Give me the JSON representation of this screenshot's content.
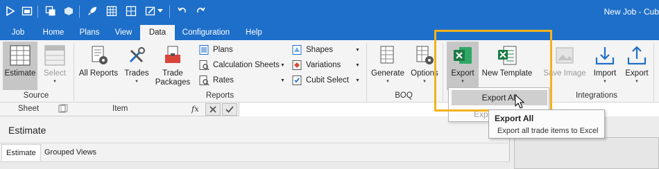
{
  "window": {
    "title": "New Job - Cub"
  },
  "tabs": [
    {
      "label": "Job"
    },
    {
      "label": "Home"
    },
    {
      "label": "Plans"
    },
    {
      "label": "View"
    },
    {
      "label": "Data"
    },
    {
      "label": "Configuration"
    },
    {
      "label": "Help"
    }
  ],
  "active_tab": "Data",
  "ribbon": {
    "source": {
      "label": "Source",
      "estimate": "Estimate",
      "select": "Select"
    },
    "reports": {
      "label": "Reports",
      "all_reports": "All Reports",
      "trades": "Trades",
      "trade_packages": "Trade\nPackages",
      "plans": "Plans",
      "calculation_sheets": "Calculation Sheets",
      "rates": "Rates",
      "shapes": "Shapes",
      "variations": "Variations",
      "cubit_select": "Cubit Select"
    },
    "boq": {
      "label": "BOQ",
      "generate": "Generate",
      "options": "Options"
    },
    "excel": {
      "export": "Export",
      "new_template": "New Template"
    },
    "integrations": {
      "label": "Integrations",
      "save_image": "Save Image",
      "import": "Import",
      "export": "Export"
    }
  },
  "formula_bar": {
    "sheet": "Sheet",
    "item": "Item",
    "fx": "fx"
  },
  "pane": {
    "title": "Estimate",
    "tabs": [
      {
        "label": "Estimate"
      },
      {
        "label": "Grouped Views"
      }
    ]
  },
  "dropdown": {
    "export_all": "Export All",
    "ghost": "Expo"
  },
  "tooltip": {
    "title": "Export All",
    "description": "Export all trade items to Excel"
  },
  "colors": {
    "accent": "#1e6fc9",
    "highlight": "#f2b21a",
    "excel": "#1d7a45"
  }
}
